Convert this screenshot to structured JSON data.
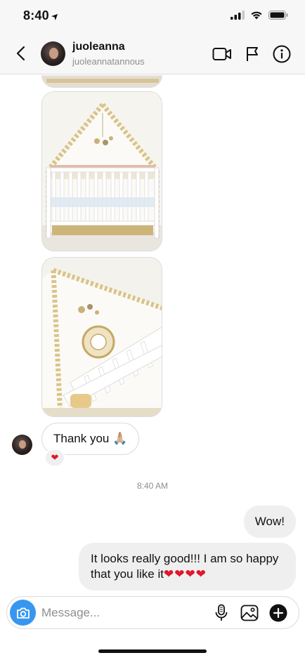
{
  "status_bar": {
    "time": "8:40"
  },
  "header": {
    "name": "juoleanna",
    "username": "juoleannatannous"
  },
  "icons": {
    "back": "chevron-left-icon",
    "video": "video-camera-icon",
    "flag": "flag-icon",
    "info": "info-icon",
    "camera": "camera-icon",
    "mic": "microphone-icon",
    "gallery": "image-icon",
    "add": "plus-icon"
  },
  "messages": {
    "incoming_text": "Thank you",
    "incoming_emoji": "🙏🏼",
    "reaction": "❤",
    "timestamp": "8:40 AM",
    "outgoing_short": "Wow!",
    "outgoing_long_text": "It looks really good!!! I am so happy that you like it",
    "outgoing_long_hearts": "❤❤❤❤"
  },
  "composer": {
    "placeholder": "Message..."
  },
  "colors": {
    "accent_blue": "#3797f0",
    "heart_red": "#e0172c",
    "bubble_gray": "#efefef",
    "secondary_text": "#8e8e8e"
  }
}
